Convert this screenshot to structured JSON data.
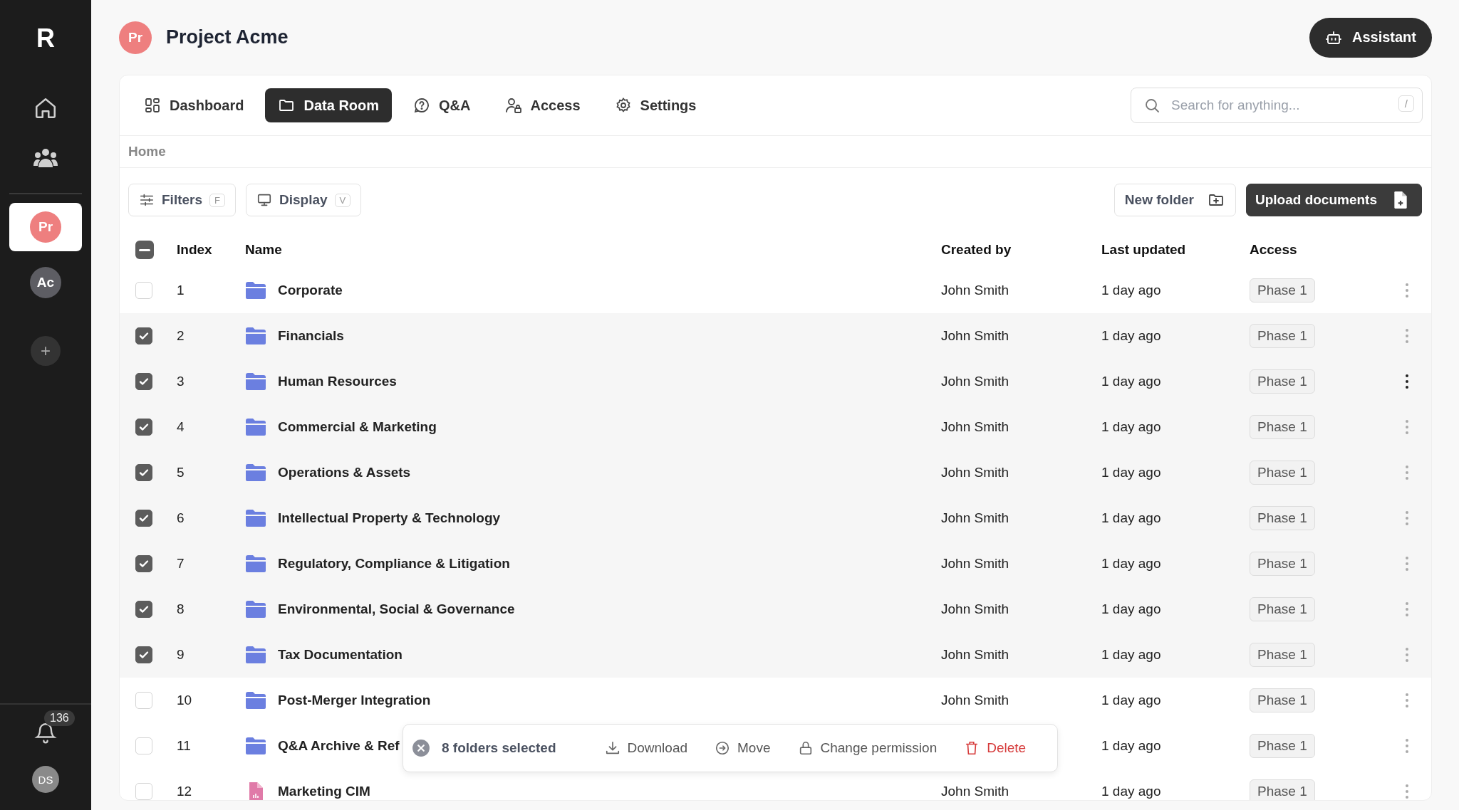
{
  "sidebar": {
    "logo": "R",
    "projects": [
      {
        "initials": "Pr",
        "color": "#ee7f7f",
        "selected": true
      },
      {
        "initials": "Ac",
        "color": "#5d5d63",
        "selected": false
      }
    ],
    "add_button": "+",
    "notifications": {
      "count": "136"
    },
    "user": {
      "initials": "DS"
    }
  },
  "header": {
    "avatar": "Pr",
    "title": "Project Acme",
    "assistant_button": "Assistant"
  },
  "tabs": [
    {
      "label": "Dashboard",
      "selected": false
    },
    {
      "label": "Data Room",
      "selected": true
    },
    {
      "label": "Q&A",
      "selected": false
    },
    {
      "label": "Access",
      "selected": false
    },
    {
      "label": "Settings",
      "selected": false
    }
  ],
  "search": {
    "placeholder": "Search for anything...",
    "shortcut": "/"
  },
  "breadcrumb": [
    "Home"
  ],
  "toolbar": {
    "filters": {
      "label": "Filters",
      "shortcut": "F"
    },
    "display": {
      "label": "Display",
      "shortcut": "V"
    },
    "new_folder": "New folder",
    "upload": "Upload documents"
  },
  "table": {
    "select_all": {
      "indeterminate": true
    },
    "columns": [
      "Index",
      "Name",
      "Created by",
      "Last updated",
      "Access"
    ],
    "rows": [
      {
        "index": "1",
        "kind": "folder",
        "name": "Corporate",
        "created_by": "John Smith",
        "last_updated": "1 day ago",
        "access": "Phase 1",
        "checked": false,
        "hovered": false
      },
      {
        "index": "2",
        "kind": "folder",
        "name": "Financials",
        "created_by": "John Smith",
        "last_updated": "1 day ago",
        "access": "Phase 1",
        "checked": true,
        "hovered": false
      },
      {
        "index": "3",
        "kind": "folder",
        "name": "Human Resources",
        "created_by": "John Smith",
        "last_updated": "1 day ago",
        "access": "Phase 1",
        "checked": true,
        "hovered": true
      },
      {
        "index": "4",
        "kind": "folder",
        "name": "Commercial & Marketing",
        "created_by": "John Smith",
        "last_updated": "1 day ago",
        "access": "Phase 1",
        "checked": true,
        "hovered": false
      },
      {
        "index": "5",
        "kind": "folder",
        "name": "Operations & Assets",
        "created_by": "John Smith",
        "last_updated": "1 day ago",
        "access": "Phase 1",
        "checked": true,
        "hovered": false
      },
      {
        "index": "6",
        "kind": "folder",
        "name": "Intellectual Property & Technology",
        "created_by": "John Smith",
        "last_updated": "1 day ago",
        "access": "Phase 1",
        "checked": true,
        "hovered": false
      },
      {
        "index": "7",
        "kind": "folder",
        "name": "Regulatory, Compliance & Litigation",
        "created_by": "John Smith",
        "last_updated": "1 day ago",
        "access": "Phase 1",
        "checked": true,
        "hovered": false
      },
      {
        "index": "8",
        "kind": "folder",
        "name": "Environmental, Social & Governance",
        "created_by": "John Smith",
        "last_updated": "1 day ago",
        "access": "Phase 1",
        "checked": true,
        "hovered": false
      },
      {
        "index": "9",
        "kind": "folder",
        "name": "Tax Documentation",
        "created_by": "John Smith",
        "last_updated": "1 day ago",
        "access": "Phase 1",
        "checked": true,
        "hovered": false
      },
      {
        "index": "10",
        "kind": "folder",
        "name": "Post-Merger Integration",
        "created_by": "John Smith",
        "last_updated": "1 day ago",
        "access": "Phase 1",
        "checked": false,
        "hovered": false
      },
      {
        "index": "11",
        "kind": "folder",
        "name": "Q&A Archive & Ref",
        "last_updated": "1 day ago",
        "access": "Phase 1",
        "checked": false,
        "hovered": false
      },
      {
        "index": "12",
        "kind": "file",
        "name": "Marketing CIM",
        "created_by": "John Smith",
        "last_updated": "1 day ago",
        "access": "Phase 1",
        "checked": false,
        "hovered": false
      }
    ]
  },
  "selection_bar": {
    "count_label": "8 folders selected",
    "actions": [
      {
        "label": "Download",
        "kind": "download"
      },
      {
        "label": "Move",
        "kind": "move"
      },
      {
        "label": "Change permission",
        "kind": "permission"
      },
      {
        "label": "Delete",
        "kind": "delete"
      }
    ]
  }
}
